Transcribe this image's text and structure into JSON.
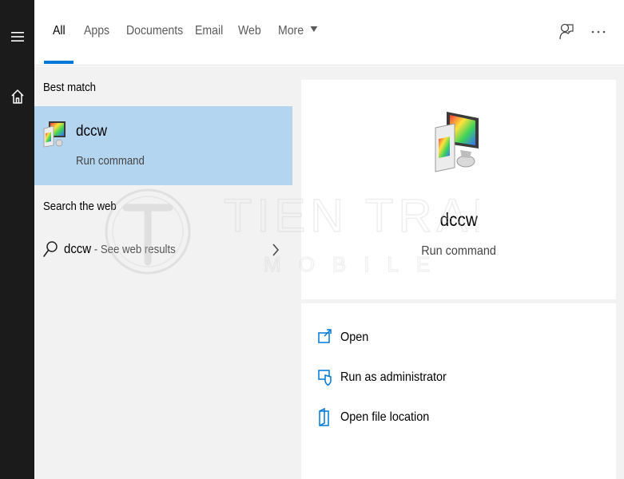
{
  "rail": {
    "icons": [
      "hamburger-menu-icon",
      "home-icon"
    ]
  },
  "tabs": [
    {
      "label": "All",
      "active": true
    },
    {
      "label": "Apps",
      "active": false
    },
    {
      "label": "Documents",
      "active": false
    },
    {
      "label": "Email",
      "active": false
    },
    {
      "label": "Web",
      "active": false
    },
    {
      "label": "More",
      "active": false,
      "icon": "caret-down-icon"
    }
  ],
  "top_icons": [
    "feedback-icon",
    "more-options-icon"
  ],
  "accent_color": "#0078d7",
  "results": {
    "best_match_header": "Best match",
    "best_match": {
      "title": "dccw",
      "subtitle": "Run command",
      "icon": "display-color-calibration-icon"
    },
    "web_header": "Search the web",
    "web_result": {
      "query": "dccw",
      "suffix": " - See web results",
      "icon": "search-icon",
      "arrow": "chevron-right-icon"
    }
  },
  "preview": {
    "title": "dccw",
    "subtitle": "Run command",
    "icon": "display-color-calibration-icon"
  },
  "actions": [
    {
      "label": "Open",
      "icon": "open-window-icon"
    },
    {
      "label": "Run as administrator",
      "icon": "shield-admin-icon"
    },
    {
      "label": "Open file location",
      "icon": "file-location-icon"
    }
  ],
  "watermark": {
    "line1": "TIEN TRAN",
    "line2": "MOBILE",
    "logo": "T"
  }
}
